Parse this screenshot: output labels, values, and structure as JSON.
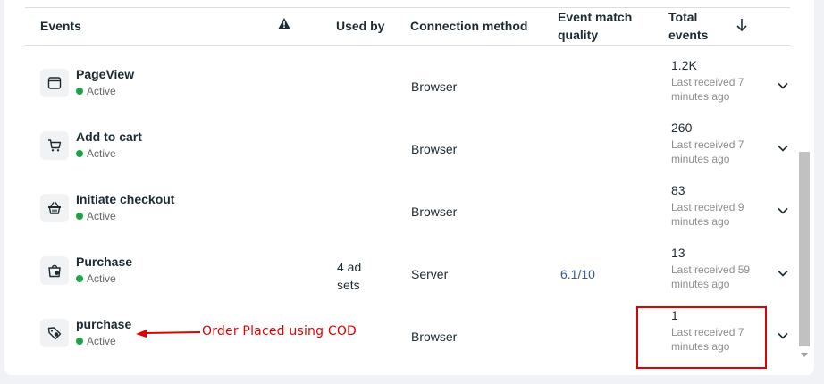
{
  "table": {
    "columns": {
      "events": "Events",
      "used_by": "Used by",
      "connection": "Connection method",
      "emq_line1": "Event match",
      "emq_line2": "quality",
      "total_line1": "Total",
      "total_line2": "events"
    },
    "rows": [
      {
        "name": "PageView",
        "status": "Active",
        "icon": "browser-window-icon",
        "used_by": "",
        "connection": "Browser",
        "emq": "",
        "total": "1.2K",
        "received_line1": "Last received 7",
        "received_line2": "minutes ago"
      },
      {
        "name": "Add to cart",
        "status": "Active",
        "icon": "shopping-cart-icon",
        "used_by": "",
        "connection": "Browser",
        "emq": "",
        "total": "260",
        "received_line1": "Last received 7",
        "received_line2": "minutes ago"
      },
      {
        "name": "Initiate checkout",
        "status": "Active",
        "icon": "basket-icon",
        "used_by": "",
        "connection": "Browser",
        "emq": "",
        "total": "83",
        "received_line1": "Last received 9",
        "received_line2": "minutes ago"
      },
      {
        "name": "Purchase",
        "status": "Active",
        "icon": "shopping-bag-icon",
        "used_by_line1": "4 ad",
        "used_by_line2": "sets",
        "connection": "Server",
        "emq": "6.1/10",
        "total": "13",
        "received_line1": "Last received 59",
        "received_line2": "minutes ago"
      },
      {
        "name": "purchase",
        "status": "Active",
        "icon": "tag-icon",
        "used_by": "",
        "connection": "Browser",
        "emq": "",
        "total": "1",
        "received_line1": "Last received 7",
        "received_line2": "minutes ago"
      }
    ]
  },
  "annotation": {
    "text": "Order Placed using COD",
    "color": "#e00000"
  },
  "colors": {
    "active_dot": "#1ea446",
    "link": "#385898"
  }
}
